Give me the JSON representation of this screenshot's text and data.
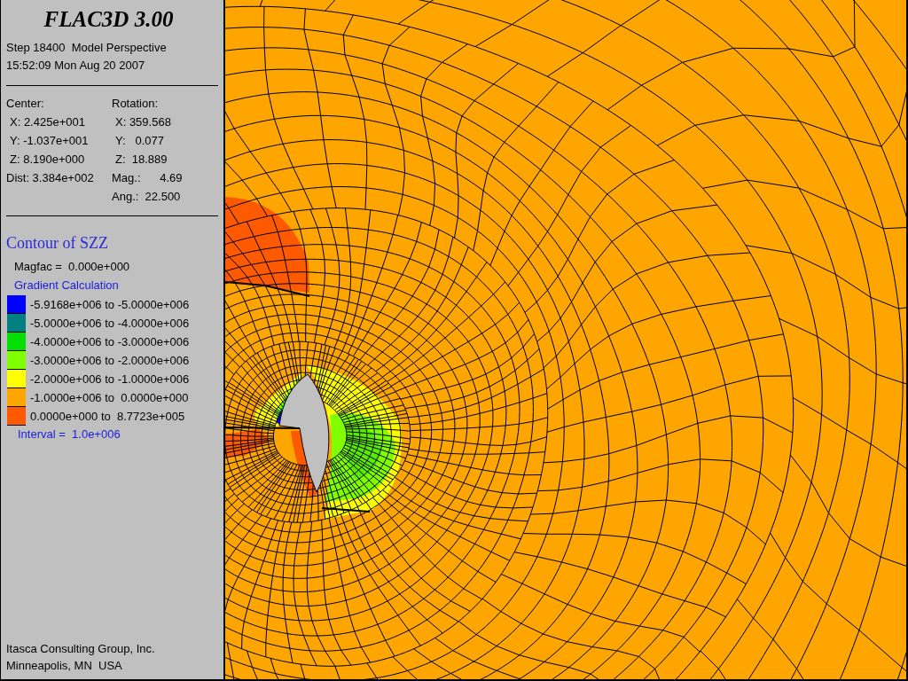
{
  "title": "FLAC3D 3.00",
  "header_lines": [
    "Step 18400  Model Perspective",
    "15:52:09 Mon Aug 20 2007"
  ],
  "view": {
    "center": {
      "label": "Center:",
      "rows": [
        {
          "kind": "axis",
          "text": "X: 2.425e+001"
        },
        {
          "kind": "axis",
          "text": "Y: -1.037e+001"
        },
        {
          "kind": "axis",
          "text": "Z: 8.190e+000"
        },
        {
          "kind": "summary",
          "text": "Dist: 3.384e+002"
        }
      ]
    },
    "rotation": {
      "label": "Rotation:",
      "rows": [
        {
          "kind": "axis",
          "text": "X: 359.568"
        },
        {
          "kind": "axis",
          "text": "Y:   0.077"
        },
        {
          "kind": "axis",
          "text": "Z:  18.889"
        },
        {
          "kind": "summary",
          "text": "Mag.:      4.69"
        },
        {
          "kind": "summary",
          "text": "Ang.:  22.500"
        }
      ]
    }
  },
  "legend": {
    "title": "Contour of SZZ",
    "magfac": "Magfac =  0.000e+000",
    "method": "Gradient Calculation",
    "bands": [
      {
        "color": "#0000ff",
        "range": "-5.9168e+006 to -5.0000e+006"
      },
      {
        "color": "#008080",
        "range": "-5.0000e+006 to -4.0000e+006"
      },
      {
        "color": "#00e000",
        "range": "-4.0000e+006 to -3.0000e+006"
      },
      {
        "color": "#80ff00",
        "range": "-3.0000e+006 to -2.0000e+006"
      },
      {
        "color": "#ffff00",
        "range": "-2.0000e+006 to -1.0000e+006"
      },
      {
        "color": "#ffa500",
        "range": "-1.0000e+006 to  0.0000e+000"
      },
      {
        "color": "#ff5a00",
        "range": "0.0000e+000 to  8.7723e+005"
      }
    ],
    "interval": "Interval =  1.0e+006"
  },
  "footer": [
    "Itasca Consulting Group, Inc.",
    "Minneapolis, MN  USA"
  ]
}
